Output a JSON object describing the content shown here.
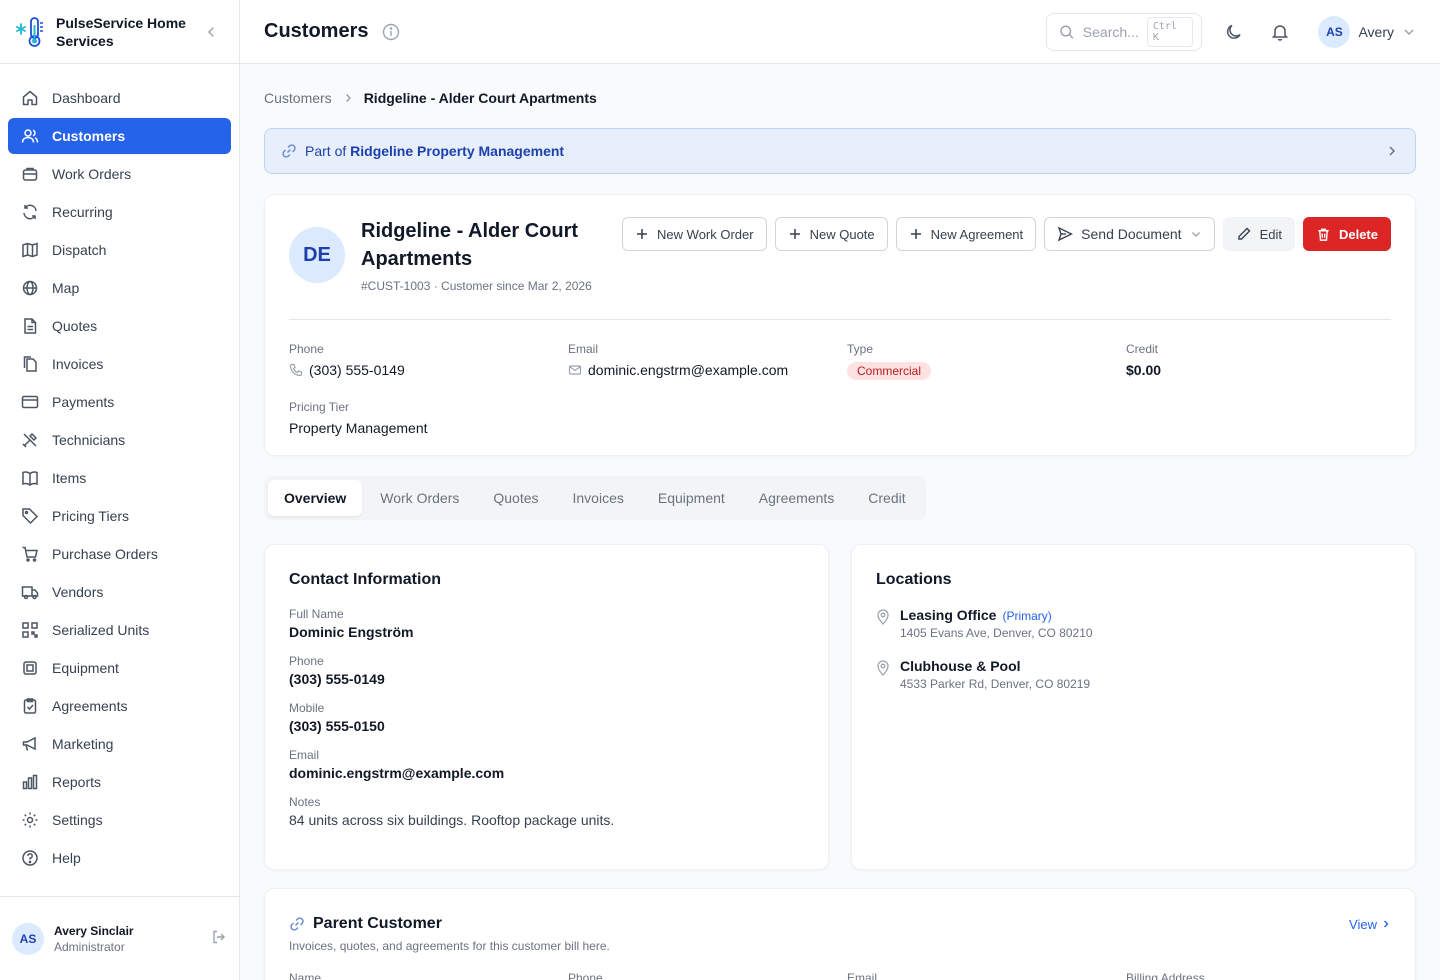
{
  "brand": {
    "name": "PulseService Home Services"
  },
  "sidebar": {
    "items": [
      {
        "label": "Dashboard",
        "icon": "home-icon"
      },
      {
        "label": "Customers",
        "icon": "users-icon",
        "active": true
      },
      {
        "label": "Work Orders",
        "icon": "work-orders-icon"
      },
      {
        "label": "Recurring",
        "icon": "recurring-icon"
      },
      {
        "label": "Dispatch",
        "icon": "dispatch-icon"
      },
      {
        "label": "Map",
        "icon": "globe-icon"
      },
      {
        "label": "Quotes",
        "icon": "document-icon"
      },
      {
        "label": "Invoices",
        "icon": "copy-icon"
      },
      {
        "label": "Payments",
        "icon": "credit-card-icon"
      },
      {
        "label": "Technicians",
        "icon": "tools-icon"
      },
      {
        "label": "Items",
        "icon": "book-icon"
      },
      {
        "label": "Pricing Tiers",
        "icon": "tag-icon"
      },
      {
        "label": "Purchase Orders",
        "icon": "cart-icon"
      },
      {
        "label": "Vendors",
        "icon": "truck-icon"
      },
      {
        "label": "Serialized Units",
        "icon": "qr-icon"
      },
      {
        "label": "Equipment",
        "icon": "chip-icon"
      },
      {
        "label": "Agreements",
        "icon": "clipboard-icon"
      },
      {
        "label": "Marketing",
        "icon": "megaphone-icon"
      },
      {
        "label": "Reports",
        "icon": "bar-chart-icon"
      },
      {
        "label": "Settings",
        "icon": "gear-icon"
      },
      {
        "label": "Help",
        "icon": "help-icon"
      }
    ],
    "footer": {
      "initials": "AS",
      "name": "Avery Sinclair",
      "role": "Administrator"
    }
  },
  "topbar": {
    "title": "Customers",
    "search_placeholder": "Search...",
    "shortcut": "Ctrl K",
    "user_initials": "AS",
    "user_name": "Avery"
  },
  "breadcrumb": {
    "parent": "Customers",
    "current": "Ridgeline - Alder Court Apartments"
  },
  "parent_banner": {
    "prefix": "Part of",
    "name": "Ridgeline Property Management"
  },
  "customer": {
    "initials": "DE",
    "name": "Ridgeline - Alder Court Apartments",
    "subtitle": "#CUST-1003 · Customer since Mar 2, 2026",
    "actions": {
      "new_work_order": "New Work Order",
      "new_quote": "New Quote",
      "new_agreement": "New Agreement",
      "send_document": "Send Document",
      "edit": "Edit",
      "delete": "Delete"
    },
    "fields": {
      "phone_label": "Phone",
      "phone": "(303) 555-0149",
      "email_label": "Email",
      "email": "dominic.engstrm@example.com",
      "type_label": "Type",
      "type": "Commercial",
      "credit_label": "Credit",
      "credit": "$0.00",
      "tier_label": "Pricing Tier",
      "tier": "Property Management"
    }
  },
  "tabs": [
    "Overview",
    "Work Orders",
    "Quotes",
    "Invoices",
    "Equipment",
    "Agreements",
    "Credit"
  ],
  "contact": {
    "title": "Contact Information",
    "full_name_label": "Full Name",
    "full_name": "Dominic Engström",
    "phone_label": "Phone",
    "phone": "(303) 555-0149",
    "mobile_label": "Mobile",
    "mobile": "(303) 555-0150",
    "email_label": "Email",
    "email": "dominic.engstrm@example.com",
    "notes_label": "Notes",
    "notes": "84 units across six buildings. Rooftop package units."
  },
  "locations": {
    "title": "Locations",
    "items": [
      {
        "name": "Leasing Office",
        "tag": "(Primary)",
        "address": "1405 Evans Ave, Denver, CO 80210"
      },
      {
        "name": "Clubhouse & Pool",
        "tag": "",
        "address": "4533 Parker Rd, Denver, CO 80219"
      }
    ]
  },
  "parent_customer": {
    "title": "Parent Customer",
    "view": "View",
    "subtitle": "Invoices, quotes, and agreements for this customer bill here.",
    "columns": [
      "Name",
      "Phone",
      "Email",
      "Billing Address"
    ]
  },
  "colors": {
    "accent": "#2563eb",
    "danger": "#dc2626",
    "banner_bg": "#e7effc"
  }
}
